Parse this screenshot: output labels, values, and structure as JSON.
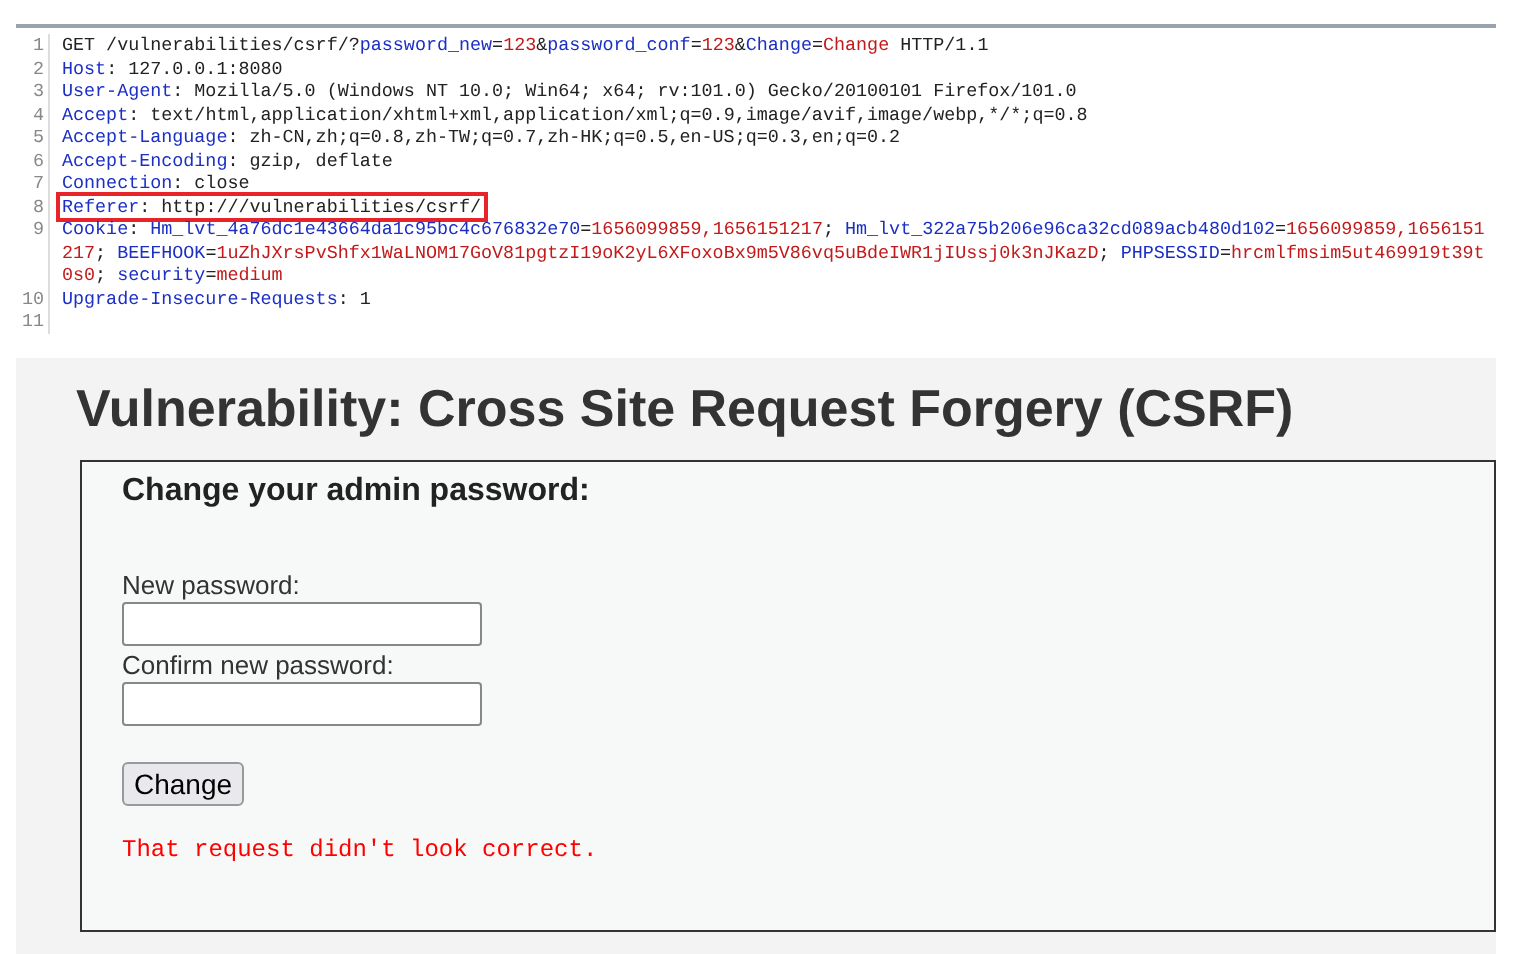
{
  "request": {
    "lines": [
      {
        "number": "1",
        "boxed": false,
        "segments": [
          {
            "kind": "plain",
            "text": "GET /vulnerabilities/csrf/?"
          },
          {
            "kind": "name",
            "text": "password_new"
          },
          {
            "kind": "plain",
            "text": "="
          },
          {
            "kind": "value",
            "text": "123"
          },
          {
            "kind": "plain",
            "text": "&"
          },
          {
            "kind": "name",
            "text": "password_conf"
          },
          {
            "kind": "plain",
            "text": "="
          },
          {
            "kind": "value",
            "text": "123"
          },
          {
            "kind": "plain",
            "text": "&"
          },
          {
            "kind": "name",
            "text": "Change"
          },
          {
            "kind": "plain",
            "text": "="
          },
          {
            "kind": "value",
            "text": "Change"
          },
          {
            "kind": "plain",
            "text": " HTTP/1.1"
          }
        ]
      },
      {
        "number": "2",
        "boxed": false,
        "segments": [
          {
            "kind": "name",
            "text": "Host"
          },
          {
            "kind": "plain",
            "text": ": 127.0.0.1:8080"
          }
        ]
      },
      {
        "number": "3",
        "boxed": false,
        "segments": [
          {
            "kind": "name",
            "text": "User-Agent"
          },
          {
            "kind": "plain",
            "text": ": Mozilla/5.0 (Windows NT 10.0; Win64; x64; rv:101.0) Gecko/20100101 Firefox/101.0"
          }
        ]
      },
      {
        "number": "4",
        "boxed": false,
        "segments": [
          {
            "kind": "name",
            "text": "Accept"
          },
          {
            "kind": "plain",
            "text": ": text/html,application/xhtml+xml,application/xml;q=0.9,image/avif,image/webp,*/*;q=0.8"
          }
        ]
      },
      {
        "number": "5",
        "boxed": false,
        "segments": [
          {
            "kind": "name",
            "text": "Accept-Language"
          },
          {
            "kind": "plain",
            "text": ": zh-CN,zh;q=0.8,zh-TW;q=0.7,zh-HK;q=0.5,en-US;q=0.3,en;q=0.2"
          }
        ]
      },
      {
        "number": "6",
        "boxed": false,
        "segments": [
          {
            "kind": "name",
            "text": "Accept-Encoding"
          },
          {
            "kind": "plain",
            "text": ": gzip, deflate"
          }
        ]
      },
      {
        "number": "7",
        "boxed": false,
        "segments": [
          {
            "kind": "name",
            "text": "Connection"
          },
          {
            "kind": "plain",
            "text": ": close"
          }
        ]
      },
      {
        "number": "8",
        "boxed": true,
        "segments": [
          {
            "kind": "name",
            "text": "Referer"
          },
          {
            "kind": "plain",
            "text": ": http:///vulnerabilities/csrf/"
          }
        ]
      },
      {
        "number": "9",
        "boxed": false,
        "segments": [
          {
            "kind": "name",
            "text": "Cookie"
          },
          {
            "kind": "plain",
            "text": ": "
          },
          {
            "kind": "name",
            "text": "Hm_lvt_4a76dc1e43664da1c95bc4c676832e70"
          },
          {
            "kind": "plain",
            "text": "="
          },
          {
            "kind": "value",
            "text": "1656099859,1656151217"
          },
          {
            "kind": "plain",
            "text": "; "
          },
          {
            "kind": "name",
            "text": "Hm_lvt_322a75b206e96ca32cd089acb480d102"
          },
          {
            "kind": "plain",
            "text": "="
          },
          {
            "kind": "value",
            "text": "1656099859,1656151217"
          },
          {
            "kind": "plain",
            "text": "; "
          },
          {
            "kind": "name",
            "text": "BEEFHOOK"
          },
          {
            "kind": "plain",
            "text": "="
          },
          {
            "kind": "value",
            "text": "1uZhJXrsPvShfx1WaLNOM17GoV81pgtzI19oK2yL6XFoxoBx9m5V86vq5uBdeIWR1jIUssj0k3nJKazD"
          },
          {
            "kind": "plain",
            "text": "; "
          },
          {
            "kind": "name",
            "text": "PHPSESSID"
          },
          {
            "kind": "plain",
            "text": "="
          },
          {
            "kind": "value",
            "text": "hrcmlfmsim5ut469919t39t0s0"
          },
          {
            "kind": "plain",
            "text": "; "
          },
          {
            "kind": "name",
            "text": "security"
          },
          {
            "kind": "plain",
            "text": "="
          },
          {
            "kind": "value",
            "text": "medium"
          }
        ]
      },
      {
        "number": "10",
        "boxed": false,
        "segments": [
          {
            "kind": "name",
            "text": "Upgrade-Insecure-Requests"
          },
          {
            "kind": "plain",
            "text": ": 1"
          }
        ]
      },
      {
        "number": "11",
        "boxed": false
      }
    ]
  },
  "page": {
    "title": "Vulnerability: Cross Site Request Forgery (CSRF)",
    "form": {
      "heading": "Change your admin password:",
      "fields": [
        {
          "label": "New password:"
        },
        {
          "label": "Confirm new password:"
        }
      ],
      "button": "Change",
      "error": "That request didn't look correct."
    }
  }
}
